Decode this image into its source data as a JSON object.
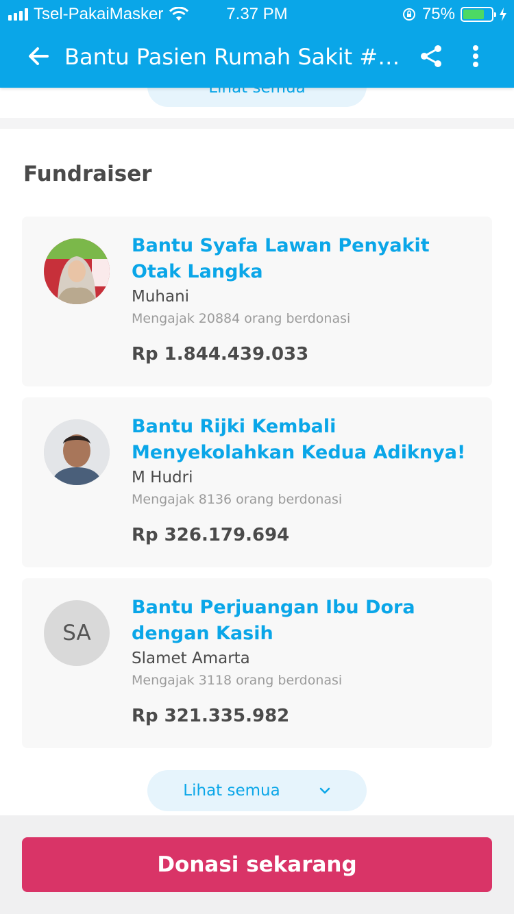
{
  "status_bar": {
    "carrier": "Tsel-PakaiMasker",
    "time": "7.37 PM",
    "battery": "75%",
    "battery_level": 0.75,
    "battery_color": "#4cd964"
  },
  "app_bar": {
    "title": "Bantu Pasien Rumah Sakit #B...",
    "back_icon": "arrow-left-icon",
    "share_icon": "share-icon",
    "more_icon": "more-vertical-icon"
  },
  "top_peek": {
    "label": "Lihat semua"
  },
  "fundraiser": {
    "title": "Fundraiser",
    "items": [
      {
        "campaign": "Bantu Syafa Lawan Penyakit Otak Langka",
        "name": "Muhani",
        "invited": "Mengajak 20884 orang berdonasi",
        "amount": "Rp 1.844.439.033"
      },
      {
        "campaign": "Bantu Rijki Kembali Menyekolahkan Kedua Adiknya!",
        "name": "M Hudri",
        "invited": "Mengajak 8136 orang berdonasi",
        "amount": "Rp 326.179.694"
      },
      {
        "campaign": "Bantu Perjuangan Ibu Dora dengan Kasih",
        "name": "Slamet Amarta",
        "initials": "SA",
        "invited": "Mengajak 3118 orang berdonasi",
        "amount": "Rp 321.335.982"
      }
    ],
    "see_all": "Lihat semua"
  },
  "cta": {
    "label": "Donasi sekarang",
    "color": "#d93467"
  },
  "colors": {
    "primary": "#0aa6e8",
    "card_bg": "#f8f8f8"
  }
}
